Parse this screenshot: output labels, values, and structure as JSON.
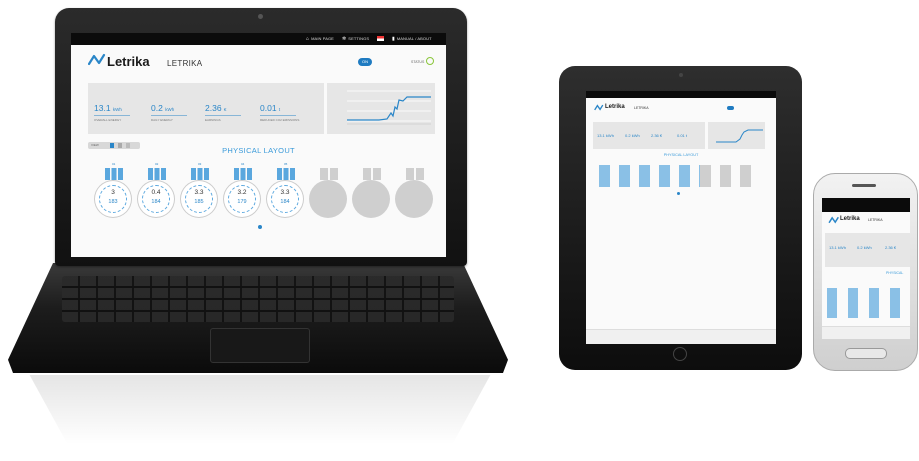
{
  "app": {
    "logo": "Letrika",
    "title": "LETRIKA",
    "nav": {
      "mainpage": "MAIN PAGE",
      "settings": "SETTINGS",
      "manual": "MANUAL / ABOUT"
    },
    "power_toggle": "ON",
    "status_label": "STATUS"
  },
  "stats": [
    {
      "value": "13.1",
      "unit": "kWh",
      "label": "OVERALL ENERGY"
    },
    {
      "value": "0.2",
      "unit": "kWh",
      "label": "DAILY ENERGY"
    },
    {
      "value": "2.36",
      "unit": "€",
      "label": "EARNINGS"
    },
    {
      "value": "0.01",
      "unit": "t",
      "label": "REDUCED CO2 EMISSIONS"
    }
  ],
  "layout": {
    "title": "PHYSICAL LAYOUT",
    "toolbar_label": "VIEW"
  },
  "modules": [
    {
      "id": "01",
      "kwh": "3",
      "w": "183"
    },
    {
      "id": "02",
      "kwh": "0.4",
      "w": "184"
    },
    {
      "id": "03",
      "kwh": "3.3",
      "w": "185"
    },
    {
      "id": "04",
      "kwh": "3.2",
      "w": "179"
    },
    {
      "id": "05",
      "kwh": "3.3",
      "w": "184"
    }
  ],
  "phone": {
    "title": "LETRIKA",
    "layout_label": "PHYSICAL",
    "stats": [
      {
        "value": "13.1",
        "unit": "kWh"
      },
      {
        "value": "0.2",
        "unit": "kWh"
      },
      {
        "value": "2.36",
        "unit": "€"
      }
    ]
  },
  "tablet": {
    "stats": [
      {
        "value": "13.1",
        "unit": "kWh"
      },
      {
        "value": "0.2",
        "unit": "kWh"
      },
      {
        "value": "2.36",
        "unit": "€"
      },
      {
        "value": "0.01",
        "unit": "t"
      }
    ],
    "layout_title": "PHYSICAL LAYOUT"
  },
  "colors": {
    "accent": "#2a86c8",
    "status_ok": "#8ac63b",
    "panel": "#e6e6e6",
    "topbar": "#0b0b0b"
  }
}
